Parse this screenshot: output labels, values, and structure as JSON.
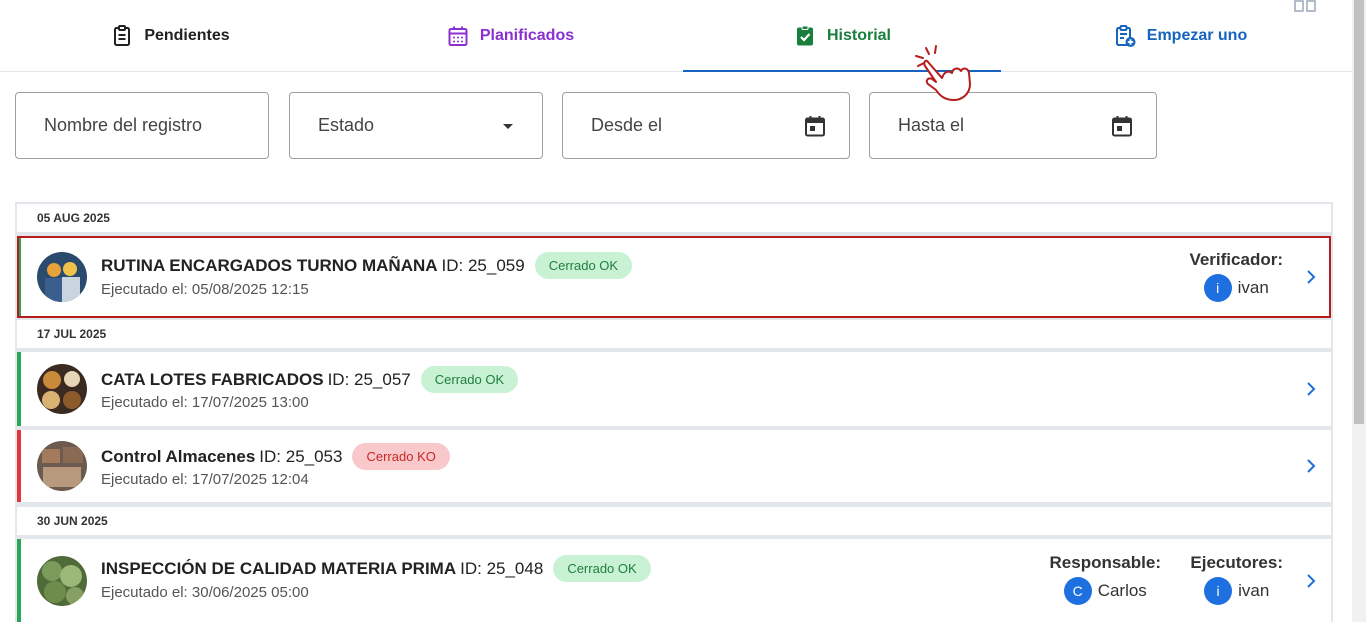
{
  "tabs": {
    "pending": "Pendientes",
    "planned": "Planificados",
    "history": "Historial",
    "start": "Empezar uno"
  },
  "filters": {
    "name": "Nombre del registro",
    "state": "Estado",
    "from": "Desde el",
    "to": "Hasta el"
  },
  "groups": [
    {
      "date": "05 AUG 2025"
    },
    {
      "date": "17 JUL 2025"
    },
    {
      "date": "30 JUN 2025"
    }
  ],
  "records": [
    {
      "title": "RUTINA ENCARGADOS TURNO MAÑANA",
      "id": "ID: 25_059",
      "status": "Cerrado OK",
      "executed": "Ejecutado el: 05/08/2025 12:15",
      "verifier_label": "Verificador:",
      "verifier_initial": "i",
      "verifier_name": "ivan"
    },
    {
      "title": "CATA LOTES FABRICADOS",
      "id": "ID: 25_057",
      "status": "Cerrado OK",
      "executed": "Ejecutado el: 17/07/2025 13:00"
    },
    {
      "title": "Control Almacenes",
      "id": "ID: 25_053",
      "status": "Cerrado KO",
      "executed": "Ejecutado el: 17/07/2025 12:04"
    },
    {
      "title": "INSPECCIÓN DE CALIDAD MATERIA PRIMA",
      "id": "ID: 25_048",
      "status": "Cerrado OK",
      "executed": "Ejecutado el: 30/06/2025 05:00",
      "responsible_label": "Responsable:",
      "responsible_initial": "C",
      "responsible_name": "Carlos",
      "executors_label": "Ejecutores:",
      "executor_initial": "i",
      "executor_name": "ivan"
    }
  ],
  "colors": {
    "ok_border": "#2aa55a",
    "ko_border": "#e5363b",
    "selected_outline": "#b71c1c",
    "accent_blue": "#1565c0",
    "planned_purple": "#8a2fd1",
    "history_green": "#1a7f3c"
  }
}
